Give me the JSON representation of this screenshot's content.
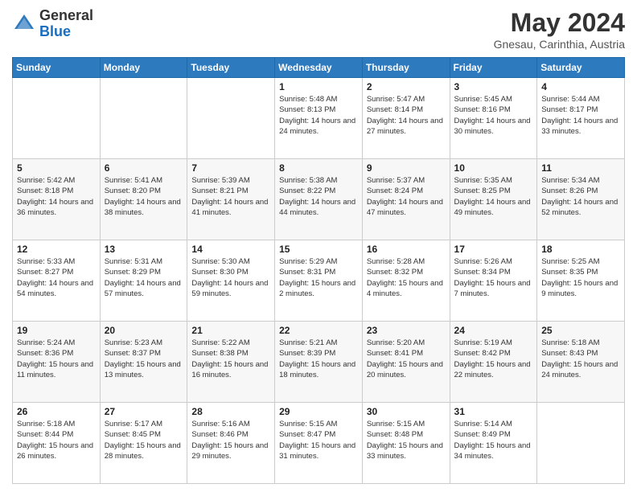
{
  "logo": {
    "line1": "General",
    "line2": "Blue"
  },
  "header": {
    "month_year": "May 2024",
    "location": "Gnesau, Carinthia, Austria"
  },
  "days_of_week": [
    "Sunday",
    "Monday",
    "Tuesday",
    "Wednesday",
    "Thursday",
    "Friday",
    "Saturday"
  ],
  "weeks": [
    [
      {
        "day": "",
        "sunrise": "",
        "sunset": "",
        "daylight": ""
      },
      {
        "day": "",
        "sunrise": "",
        "sunset": "",
        "daylight": ""
      },
      {
        "day": "",
        "sunrise": "",
        "sunset": "",
        "daylight": ""
      },
      {
        "day": "1",
        "sunrise": "Sunrise: 5:48 AM",
        "sunset": "Sunset: 8:13 PM",
        "daylight": "Daylight: 14 hours and 24 minutes."
      },
      {
        "day": "2",
        "sunrise": "Sunrise: 5:47 AM",
        "sunset": "Sunset: 8:14 PM",
        "daylight": "Daylight: 14 hours and 27 minutes."
      },
      {
        "day": "3",
        "sunrise": "Sunrise: 5:45 AM",
        "sunset": "Sunset: 8:16 PM",
        "daylight": "Daylight: 14 hours and 30 minutes."
      },
      {
        "day": "4",
        "sunrise": "Sunrise: 5:44 AM",
        "sunset": "Sunset: 8:17 PM",
        "daylight": "Daylight: 14 hours and 33 minutes."
      }
    ],
    [
      {
        "day": "5",
        "sunrise": "Sunrise: 5:42 AM",
        "sunset": "Sunset: 8:18 PM",
        "daylight": "Daylight: 14 hours and 36 minutes."
      },
      {
        "day": "6",
        "sunrise": "Sunrise: 5:41 AM",
        "sunset": "Sunset: 8:20 PM",
        "daylight": "Daylight: 14 hours and 38 minutes."
      },
      {
        "day": "7",
        "sunrise": "Sunrise: 5:39 AM",
        "sunset": "Sunset: 8:21 PM",
        "daylight": "Daylight: 14 hours and 41 minutes."
      },
      {
        "day": "8",
        "sunrise": "Sunrise: 5:38 AM",
        "sunset": "Sunset: 8:22 PM",
        "daylight": "Daylight: 14 hours and 44 minutes."
      },
      {
        "day": "9",
        "sunrise": "Sunrise: 5:37 AM",
        "sunset": "Sunset: 8:24 PM",
        "daylight": "Daylight: 14 hours and 47 minutes."
      },
      {
        "day": "10",
        "sunrise": "Sunrise: 5:35 AM",
        "sunset": "Sunset: 8:25 PM",
        "daylight": "Daylight: 14 hours and 49 minutes."
      },
      {
        "day": "11",
        "sunrise": "Sunrise: 5:34 AM",
        "sunset": "Sunset: 8:26 PM",
        "daylight": "Daylight: 14 hours and 52 minutes."
      }
    ],
    [
      {
        "day": "12",
        "sunrise": "Sunrise: 5:33 AM",
        "sunset": "Sunset: 8:27 PM",
        "daylight": "Daylight: 14 hours and 54 minutes."
      },
      {
        "day": "13",
        "sunrise": "Sunrise: 5:31 AM",
        "sunset": "Sunset: 8:29 PM",
        "daylight": "Daylight: 14 hours and 57 minutes."
      },
      {
        "day": "14",
        "sunrise": "Sunrise: 5:30 AM",
        "sunset": "Sunset: 8:30 PM",
        "daylight": "Daylight: 14 hours and 59 minutes."
      },
      {
        "day": "15",
        "sunrise": "Sunrise: 5:29 AM",
        "sunset": "Sunset: 8:31 PM",
        "daylight": "Daylight: 15 hours and 2 minutes."
      },
      {
        "day": "16",
        "sunrise": "Sunrise: 5:28 AM",
        "sunset": "Sunset: 8:32 PM",
        "daylight": "Daylight: 15 hours and 4 minutes."
      },
      {
        "day": "17",
        "sunrise": "Sunrise: 5:26 AM",
        "sunset": "Sunset: 8:34 PM",
        "daylight": "Daylight: 15 hours and 7 minutes."
      },
      {
        "day": "18",
        "sunrise": "Sunrise: 5:25 AM",
        "sunset": "Sunset: 8:35 PM",
        "daylight": "Daylight: 15 hours and 9 minutes."
      }
    ],
    [
      {
        "day": "19",
        "sunrise": "Sunrise: 5:24 AM",
        "sunset": "Sunset: 8:36 PM",
        "daylight": "Daylight: 15 hours and 11 minutes."
      },
      {
        "day": "20",
        "sunrise": "Sunrise: 5:23 AM",
        "sunset": "Sunset: 8:37 PM",
        "daylight": "Daylight: 15 hours and 13 minutes."
      },
      {
        "day": "21",
        "sunrise": "Sunrise: 5:22 AM",
        "sunset": "Sunset: 8:38 PM",
        "daylight": "Daylight: 15 hours and 16 minutes."
      },
      {
        "day": "22",
        "sunrise": "Sunrise: 5:21 AM",
        "sunset": "Sunset: 8:39 PM",
        "daylight": "Daylight: 15 hours and 18 minutes."
      },
      {
        "day": "23",
        "sunrise": "Sunrise: 5:20 AM",
        "sunset": "Sunset: 8:41 PM",
        "daylight": "Daylight: 15 hours and 20 minutes."
      },
      {
        "day": "24",
        "sunrise": "Sunrise: 5:19 AM",
        "sunset": "Sunset: 8:42 PM",
        "daylight": "Daylight: 15 hours and 22 minutes."
      },
      {
        "day": "25",
        "sunrise": "Sunrise: 5:18 AM",
        "sunset": "Sunset: 8:43 PM",
        "daylight": "Daylight: 15 hours and 24 minutes."
      }
    ],
    [
      {
        "day": "26",
        "sunrise": "Sunrise: 5:18 AM",
        "sunset": "Sunset: 8:44 PM",
        "daylight": "Daylight: 15 hours and 26 minutes."
      },
      {
        "day": "27",
        "sunrise": "Sunrise: 5:17 AM",
        "sunset": "Sunset: 8:45 PM",
        "daylight": "Daylight: 15 hours and 28 minutes."
      },
      {
        "day": "28",
        "sunrise": "Sunrise: 5:16 AM",
        "sunset": "Sunset: 8:46 PM",
        "daylight": "Daylight: 15 hours and 29 minutes."
      },
      {
        "day": "29",
        "sunrise": "Sunrise: 5:15 AM",
        "sunset": "Sunset: 8:47 PM",
        "daylight": "Daylight: 15 hours and 31 minutes."
      },
      {
        "day": "30",
        "sunrise": "Sunrise: 5:15 AM",
        "sunset": "Sunset: 8:48 PM",
        "daylight": "Daylight: 15 hours and 33 minutes."
      },
      {
        "day": "31",
        "sunrise": "Sunrise: 5:14 AM",
        "sunset": "Sunset: 8:49 PM",
        "daylight": "Daylight: 15 hours and 34 minutes."
      },
      {
        "day": "",
        "sunrise": "",
        "sunset": "",
        "daylight": ""
      }
    ]
  ]
}
